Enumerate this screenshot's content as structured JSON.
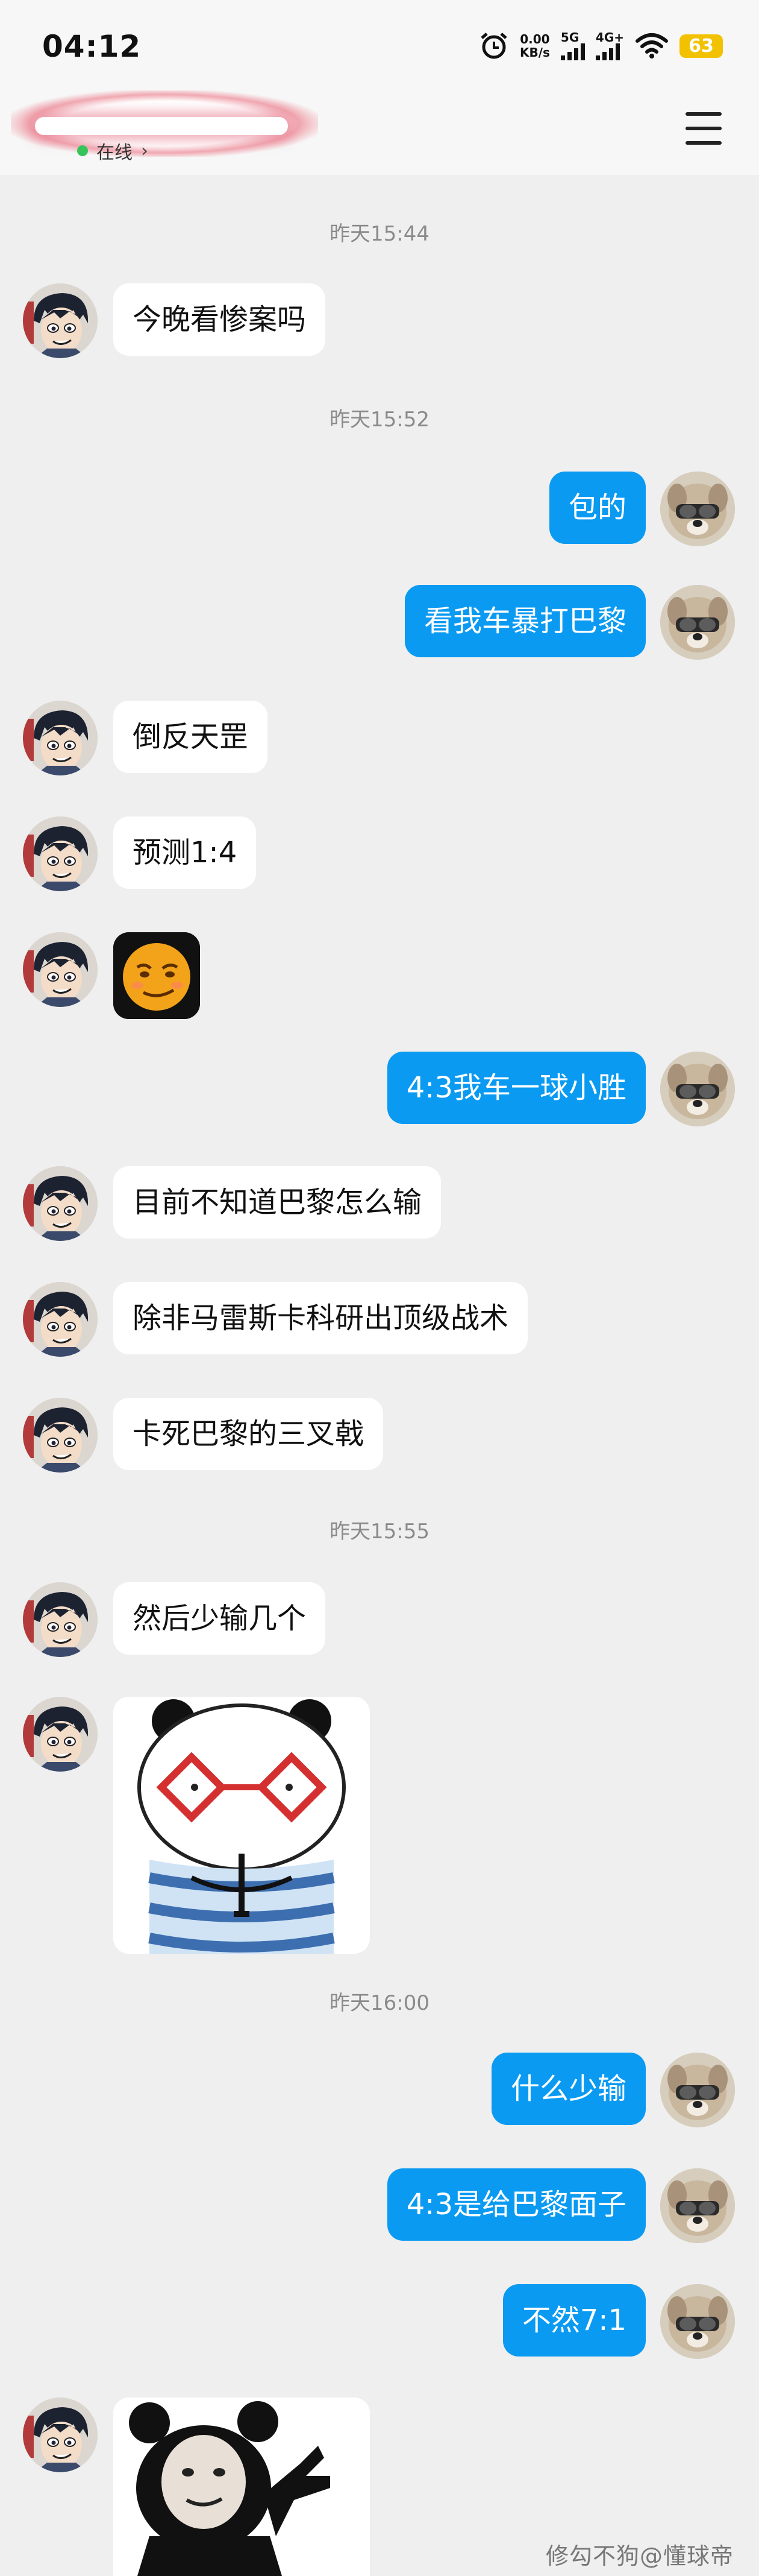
{
  "status_bar": {
    "time": "04:12",
    "net_speed_value": "0.00",
    "net_speed_unit": "KB/s",
    "network_1": "5G",
    "network_2": "4G+",
    "battery": "63"
  },
  "header": {
    "status": "在线",
    "chevron": "›"
  },
  "messages": {
    "ts1": "昨天15:44",
    "m1": "今晚看惨案吗",
    "ts2": "昨天15:52",
    "m2": "包的",
    "m3": "看我车暴打巴黎",
    "m4": "倒反天罡",
    "m5": "预测1:4",
    "m7": "4:3我车一球小胜",
    "m8": "目前不知道巴黎怎么输",
    "m9": "除非马雷斯卡科研出顶级战术",
    "m10": "卡死巴黎的三叉戟",
    "ts3": "昨天15:55",
    "m11": "然后少输几个",
    "ts4": "昨天16:00",
    "m13": "什么少输",
    "m14": "4:3是给巴黎面子",
    "m15": "不然7:1"
  },
  "watermark": "修勾不狗@懂球帝",
  "colors": {
    "background": "#efefef",
    "outgoing_bubble": "#0a9af2",
    "incoming_bubble": "#ffffff",
    "online_dot": "#35c45a",
    "battery": "#f2c200"
  }
}
